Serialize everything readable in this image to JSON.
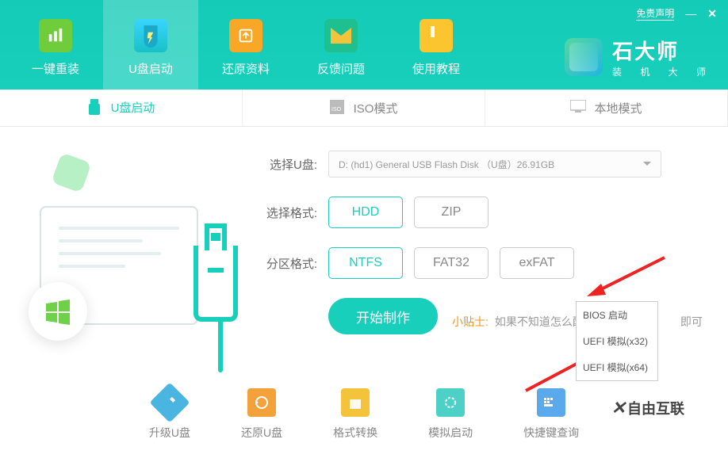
{
  "titlebar": {
    "disclaimer": "免责声明",
    "minimize": "—",
    "close": "✕"
  },
  "nav": {
    "items": [
      {
        "label": "一键重装"
      },
      {
        "label": "U盘启动"
      },
      {
        "label": "还原资料"
      },
      {
        "label": "反馈问题"
      },
      {
        "label": "使用教程"
      }
    ]
  },
  "brand": {
    "name": "石大师",
    "subtitle": "装 机 大 师"
  },
  "tabs": {
    "usb": "U盘启动",
    "iso": "ISO模式",
    "local": "本地模式"
  },
  "form": {
    "select_usb_label": "选择U盘:",
    "select_usb_value": "D: (hd1) General USB Flash Disk （U盘）26.91GB",
    "format_label": "选择格式:",
    "format_options": [
      "HDD",
      "ZIP"
    ],
    "fs_label": "分区格式:",
    "fs_options": [
      "NTFS",
      "FAT32",
      "exFAT"
    ],
    "start_btn": "开始制作",
    "tip_label": "小贴士:",
    "tip_text": "如果不知道怎么配置",
    "tip_tail": "即可"
  },
  "popup": {
    "items": [
      "BIOS 启动",
      "UEFI 模拟(x32)",
      "UEFI 模拟(x64)"
    ]
  },
  "tools": {
    "items": [
      "升级U盘",
      "还原U盘",
      "格式转换",
      "模拟启动",
      "快捷键查询"
    ]
  },
  "watermark": "自由互联"
}
